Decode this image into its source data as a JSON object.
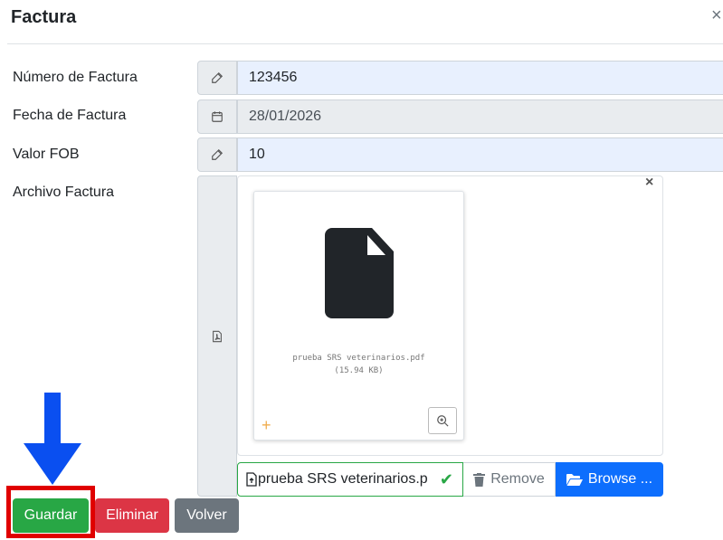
{
  "modal": {
    "title": "Factura",
    "close_glyph": "×"
  },
  "form": {
    "numero": {
      "label": "Número de Factura",
      "value": "123456",
      "icon": "edit-icon"
    },
    "fecha": {
      "label": "Fecha de Factura",
      "value": "28/01/2026",
      "icon": "calendar-icon"
    },
    "fob": {
      "label": "Valor FOB",
      "value": "10",
      "icon": "edit-icon"
    },
    "archivo": {
      "label": "Archivo Factura",
      "icon": "pdf-file-icon",
      "preview": {
        "file_name": "prueba SRS veterinarios.pdf",
        "file_size": "(15.94 KB)",
        "close_glyph": "×",
        "plus_glyph": "+"
      },
      "caption": "prueba SRS veterinarios.p",
      "check_glyph": "✔",
      "remove_label": "Remove",
      "browse_label": "Browse ..."
    }
  },
  "buttons": {
    "save": "Guardar",
    "delete": "Eliminar",
    "back": "Volver"
  },
  "colors": {
    "save": "#28a745",
    "delete": "#dc3545",
    "back": "#6c757d",
    "browse": "#0d6efd",
    "highlight": "#e00000",
    "arrow": "#0a4ff0"
  }
}
